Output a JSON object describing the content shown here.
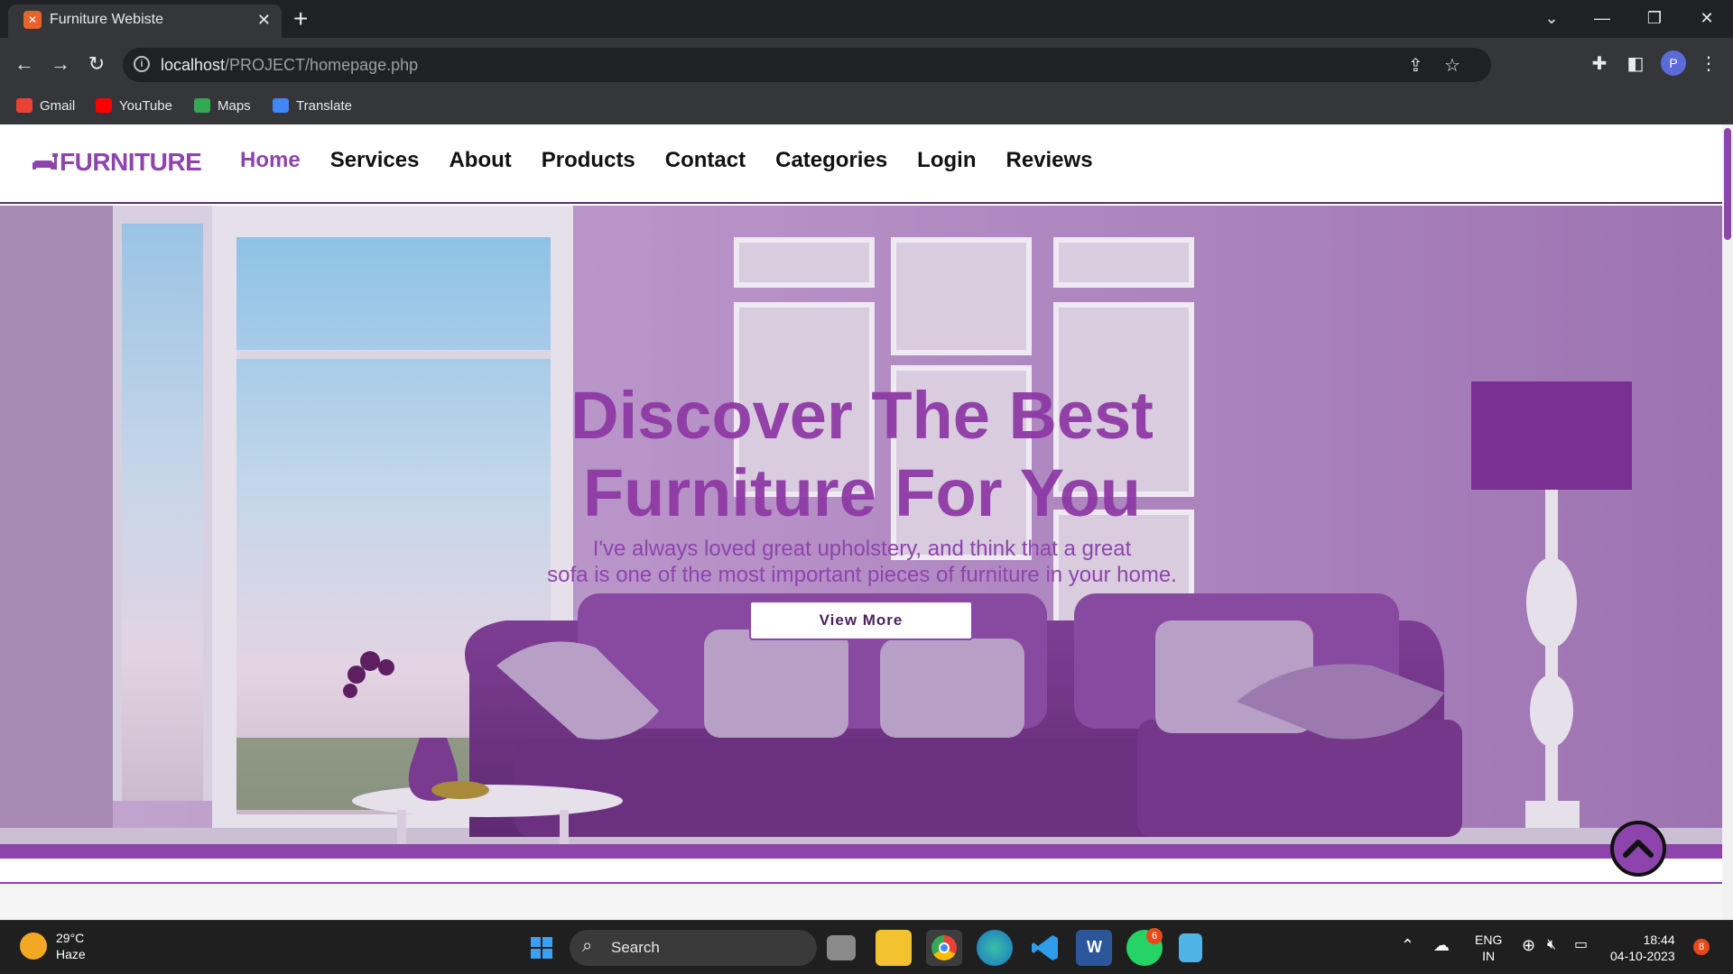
{
  "browser": {
    "tab_title": "Furniture Webiste",
    "tab_favicon": "xampp-icon",
    "url_host": "localhost",
    "url_path": "/PROJECT/homepage.php",
    "bookmarks": [
      {
        "label": "Gmail",
        "icon": "gmail-icon",
        "color": "#ea4335"
      },
      {
        "label": "YouTube",
        "icon": "youtube-icon",
        "color": "#ff0000"
      },
      {
        "label": "Maps",
        "icon": "maps-icon",
        "color": "#34a853"
      },
      {
        "label": "Translate",
        "icon": "translate-icon",
        "color": "#4285f4"
      }
    ],
    "profile_initial": "P"
  },
  "site": {
    "logo_text": "FURNITURE",
    "accent_color": "#8e44ad",
    "nav": [
      {
        "label": "Home",
        "active": true
      },
      {
        "label": "Services",
        "active": false
      },
      {
        "label": "About",
        "active": false
      },
      {
        "label": "Products",
        "active": false
      },
      {
        "label": "Contact",
        "active": false
      },
      {
        "label": "Categories",
        "active": false
      },
      {
        "label": "Login",
        "active": false
      },
      {
        "label": "Reviews",
        "active": false
      }
    ],
    "hero": {
      "title_line1": "Discover The Best",
      "title_line2": "Furniture For You",
      "subtitle_line1": "I've always loved great upholstery, and think that a great",
      "subtitle_line2": "sofa is one of the most important pieces of furniture in your home.",
      "button_label": "View More"
    }
  },
  "taskbar": {
    "weather_temp": "29°C",
    "weather_desc": "Haze",
    "search_label": "Search",
    "whatsapp_badge": "6",
    "lang_top": "ENG",
    "lang_bottom": "IN",
    "time": "18:44",
    "date": "04-10-2023",
    "notification_count": "8"
  }
}
